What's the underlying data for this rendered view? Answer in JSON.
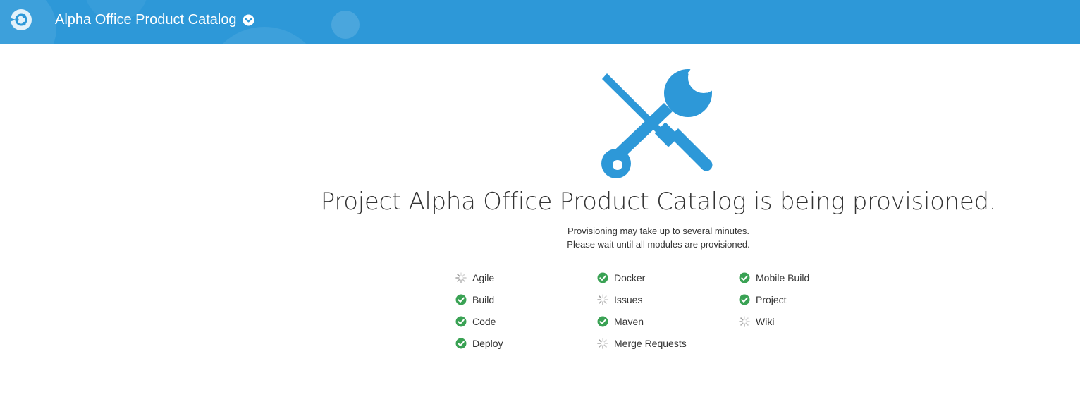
{
  "header": {
    "project_name": "Alpha Office Product Catalog",
    "brand_color": "#2d98d8",
    "logo_icon": "devcs-logo-icon",
    "dropdown_icon": "chevron-down-circle-icon"
  },
  "main": {
    "illustration_icon": "tools-icon",
    "heading": "Project Alpha Office Product Catalog is being provisioned.",
    "subtext_line1": "Provisioning may take up to several minutes.",
    "subtext_line2": "Please wait until all modules are provisioned."
  },
  "modules": {
    "columns": [
      [
        {
          "label": "Agile",
          "status": "provisioning"
        },
        {
          "label": "Build",
          "status": "done"
        },
        {
          "label": "Code",
          "status": "done"
        },
        {
          "label": "Deploy",
          "status": "done"
        }
      ],
      [
        {
          "label": "Docker",
          "status": "done"
        },
        {
          "label": "Issues",
          "status": "provisioning"
        },
        {
          "label": "Maven",
          "status": "done"
        },
        {
          "label": "Merge Requests",
          "status": "provisioning"
        }
      ],
      [
        {
          "label": "Mobile Build",
          "status": "done"
        },
        {
          "label": "Project",
          "status": "done"
        },
        {
          "label": "Wiki",
          "status": "provisioning"
        }
      ]
    ],
    "done_color": "#3aa254",
    "spinner_color": "#999999"
  }
}
